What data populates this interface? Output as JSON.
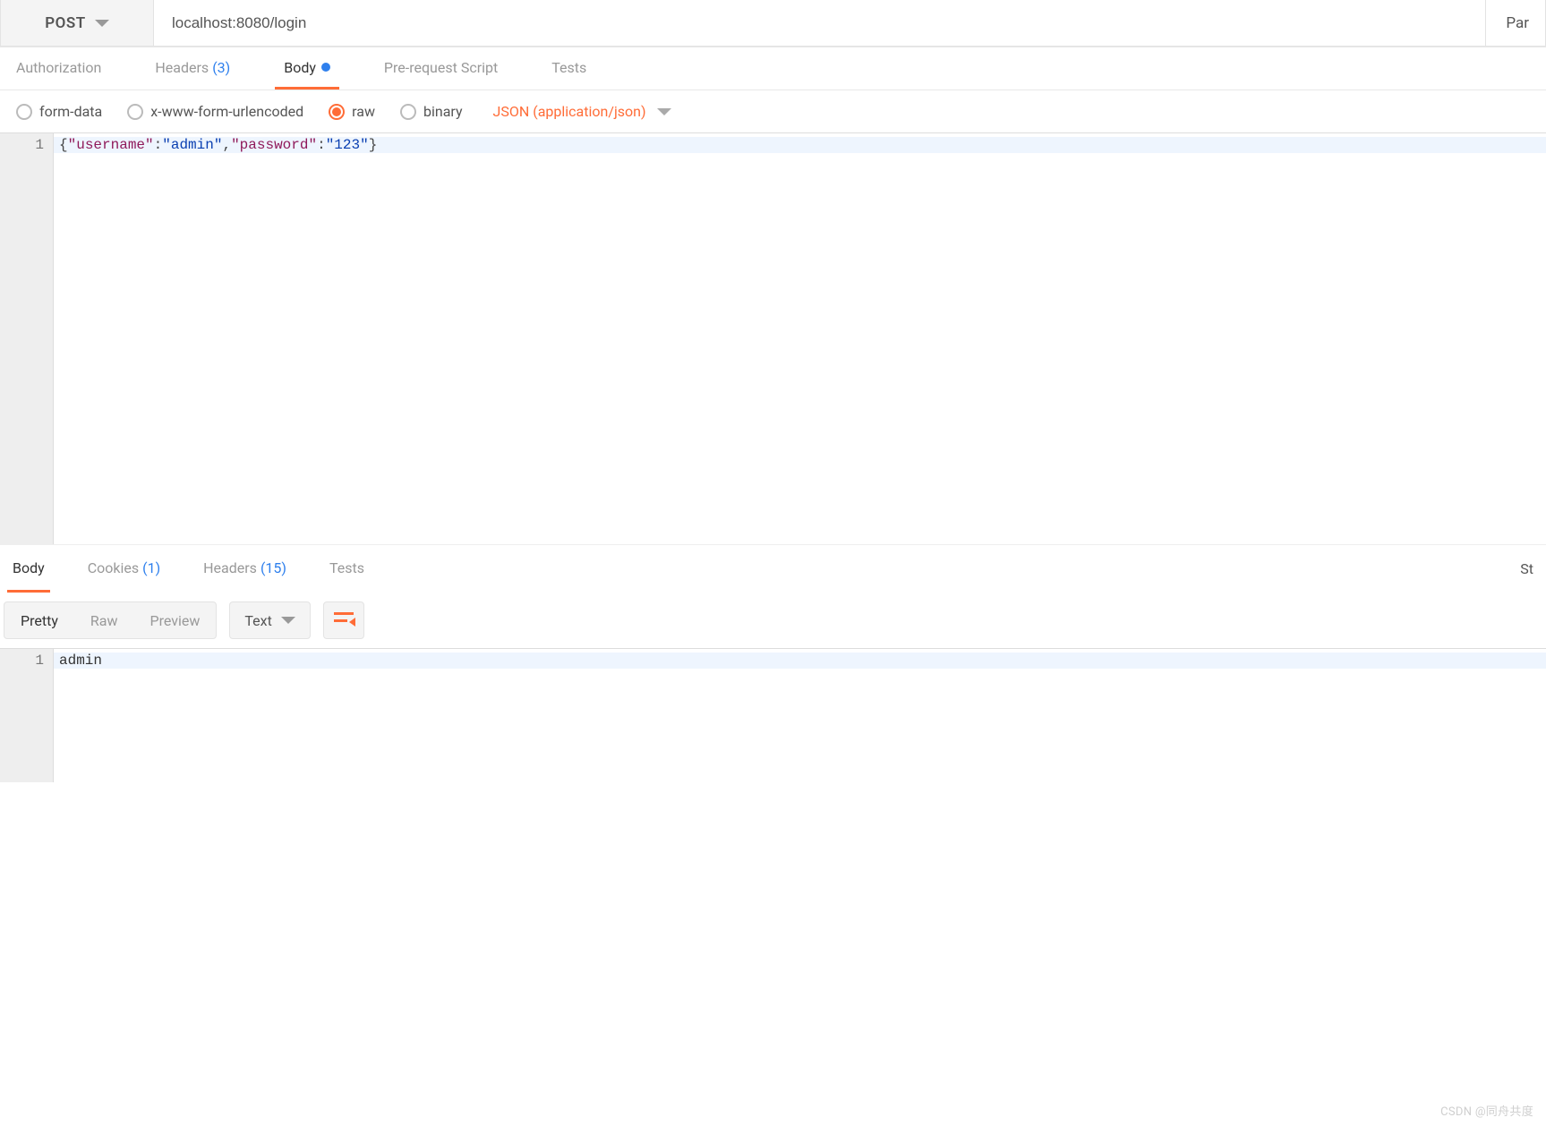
{
  "request": {
    "method": "POST",
    "url": "localhost:8080/login",
    "params_button": "Par"
  },
  "tabs": {
    "authorization": "Authorization",
    "headers_label": "Headers",
    "headers_count": "(3)",
    "body": "Body",
    "prerequest": "Pre-request Script",
    "tests": "Tests"
  },
  "body_radios": {
    "form_data": "form-data",
    "urlencoded": "x-www-form-urlencoded",
    "raw": "raw",
    "binary": "binary"
  },
  "content_type": "JSON (application/json)",
  "editor": {
    "line_no": "1",
    "json_raw": "{\"username\":\"admin\",\"password\":\"123\"}",
    "key1": "\"username\"",
    "val1": "\"admin\"",
    "key2": "\"password\"",
    "val2": "\"123\""
  },
  "response_tabs": {
    "body": "Body",
    "cookies_label": "Cookies",
    "cookies_count": "(1)",
    "headers_label": "Headers",
    "headers_count": "(15)",
    "tests": "Tests",
    "status": "St"
  },
  "view_modes": {
    "pretty": "Pretty",
    "raw": "Raw",
    "preview": "Preview",
    "text": "Text"
  },
  "response_body": {
    "line_no": "1",
    "content": "admin"
  },
  "watermark": "CSDN @同舟共度"
}
